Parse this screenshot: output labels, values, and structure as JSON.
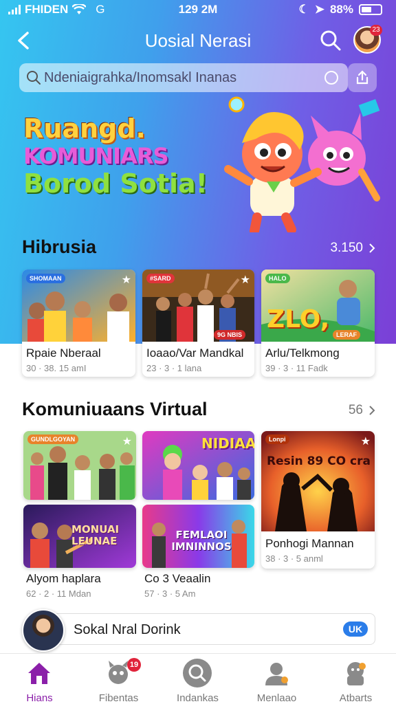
{
  "status_bar": {
    "carrier": "FHIDEN",
    "network": "G",
    "time": "129 2M",
    "battery": "88%"
  },
  "header": {
    "title": "Uosial Nerasi",
    "notification_count": "23"
  },
  "search": {
    "placeholder": "Ndeniaigrahka/Inomsakl Inanas"
  },
  "hero": {
    "line1": "Ruangd.",
    "line2": "KOMUNIARS",
    "line3": "Borod Sotia!"
  },
  "section1": {
    "title": "Hibrusia",
    "count": "3.150",
    "cards": [
      {
        "tag": "SHOMAAN",
        "title": "Rpaie Nberaal",
        "meta": "30 · 38. 15 amI",
        "pill": ""
      },
      {
        "tag": "#SARD",
        "title": "Ioaao/Var Mandkal",
        "meta": "23 · 3 · 1 lana",
        "pill": "9G NBIS"
      },
      {
        "tag": "HALO",
        "title": "Arlu/Telkmong",
        "meta": "39 · 3 · 11 Fadk",
        "pill": "LERAF",
        "thumb_text": "ZLO,"
      }
    ]
  },
  "section2": {
    "title": "Komuniuaans Virtual",
    "count": "56",
    "cards": [
      {
        "tag": "GUNDLGOYAN",
        "title": "Alyom haplara",
        "meta": "62 · 2 · 11 Mdan"
      },
      {
        "tag": "NIDIAA",
        "thumb_text": "NIDIAA",
        "title": "",
        "meta": ""
      },
      {
        "tag": "Lonpi",
        "thumb_text": "Resin 89 CO cra",
        "title": "Ponhogi Mannan",
        "meta": "38 · 3 · 5 anml"
      },
      {
        "tag": "",
        "thumb_text": "MONUAI LEUNAE",
        "title": "",
        "meta": ""
      },
      {
        "tag": "",
        "thumb_text": "FEMLAOI IMNINNOS",
        "title": "Co 3 Veaalin",
        "meta": "57 · 3 · 5 Am"
      }
    ]
  },
  "social": {
    "label": "Sokal Nral Dorink",
    "chip": "UK"
  },
  "bottom_nav": [
    {
      "label": "Hians",
      "active": true
    },
    {
      "label": "Fibentas",
      "badge": "19"
    },
    {
      "label": "Indankas"
    },
    {
      "label": "Menlaao"
    },
    {
      "label": "Atbarts"
    }
  ],
  "colors": {
    "accent": "#8b1fa9",
    "hero_start": "#35c6f0",
    "hero_end": "#7b3fd6",
    "badge": "#e0243b",
    "chip": "#2b7de9"
  }
}
